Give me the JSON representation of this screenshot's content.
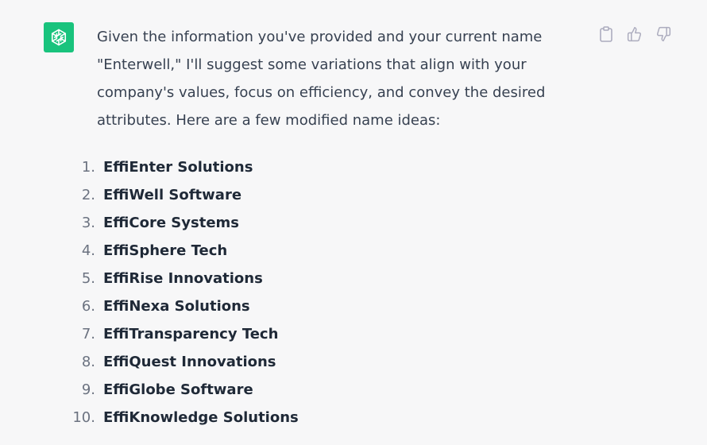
{
  "avatar": {
    "icon": "openai-logo-icon",
    "background": "#19c37d"
  },
  "message": {
    "intro_lines": [
      "Given the information you've provided and your current name",
      "\"Enterwell,\" I'll suggest some variations that align with your",
      "company's values, focus on efficiency, and convey the desired",
      "attributes. Here are a few modified name ideas:"
    ],
    "list": [
      {
        "num": "1.",
        "name": "EffiEnter Solutions"
      },
      {
        "num": "2.",
        "name": "EffiWell Software"
      },
      {
        "num": "3.",
        "name": "EffiCore Systems"
      },
      {
        "num": "4.",
        "name": "EffiSphere Tech"
      },
      {
        "num": "5.",
        "name": "EffiRise Innovations"
      },
      {
        "num": "6.",
        "name": "EffiNexa Solutions"
      },
      {
        "num": "7.",
        "name": "EffiTransparency Tech"
      },
      {
        "num": "8.",
        "name": "EffiQuest Innovations"
      },
      {
        "num": "9.",
        "name": "EffiGlobe Software"
      },
      {
        "num": "10.",
        "name": "EffiKnowledge Solutions"
      }
    ]
  },
  "actions": [
    {
      "icon": "clipboard-icon"
    },
    {
      "icon": "thumbs-up-icon"
    },
    {
      "icon": "thumbs-down-icon"
    }
  ],
  "colors": {
    "background": "#f7f7f8",
    "text": "#374151",
    "list_name": "#1f2937",
    "list_number": "#6b7280",
    "icon_gray": "#acacbe"
  }
}
